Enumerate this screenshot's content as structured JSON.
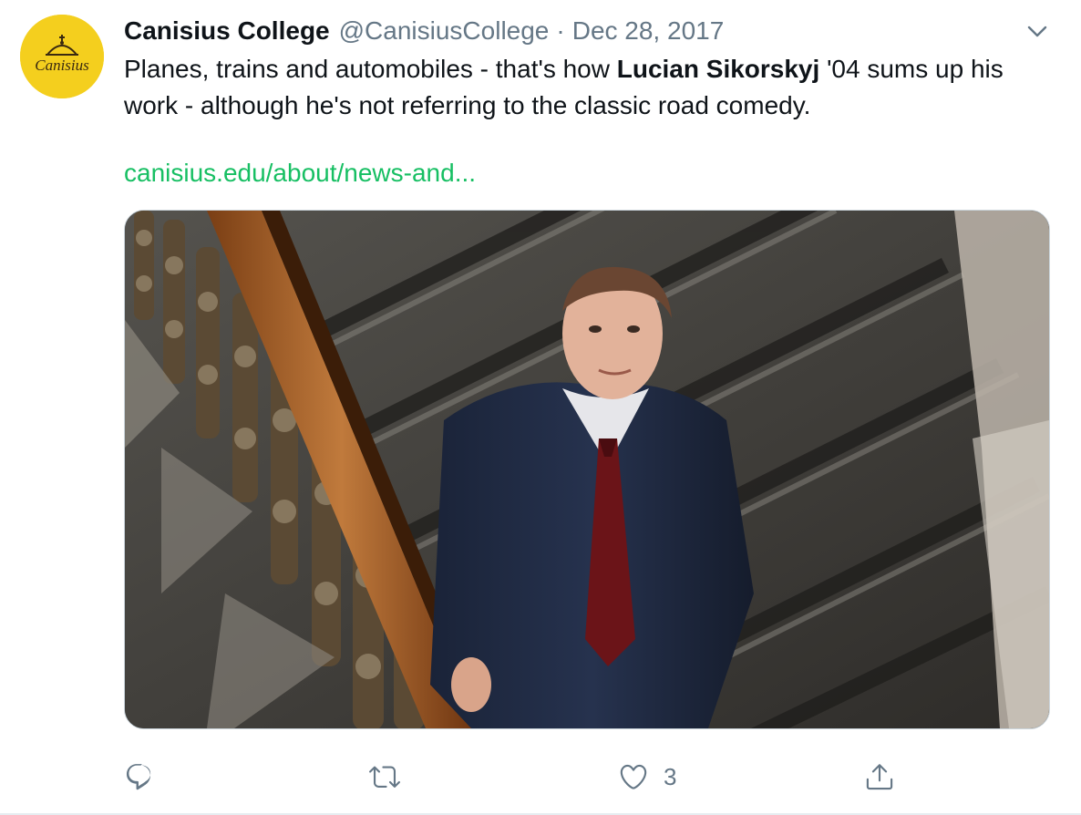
{
  "tweet": {
    "author": {
      "display_name": "Canisius College",
      "handle": "@CanisiusCollege",
      "avatar_text": "Canisius",
      "avatar_bg": "#f4cf1e"
    },
    "separator": "·",
    "date": "Dec 28, 2017",
    "text_segments": [
      "Planes, trains and automobiles - that's how ",
      "Lucian Sikorskyj",
      " '04 sums up his work - although he's not referring to the classic road comedy."
    ],
    "link_text": "canisius.edu/about/news-and...",
    "link_color": "#17bf63",
    "media": {
      "subject": "photo-man-in-suit-on-staircase"
    },
    "actions": {
      "reply": {
        "icon": "reply-icon",
        "count": ""
      },
      "retweet": {
        "icon": "retweet-icon",
        "count": ""
      },
      "like": {
        "icon": "heart-icon",
        "count": "3"
      },
      "share": {
        "icon": "share-icon",
        "count": ""
      }
    },
    "menu_icon": "chevron-down-icon"
  }
}
